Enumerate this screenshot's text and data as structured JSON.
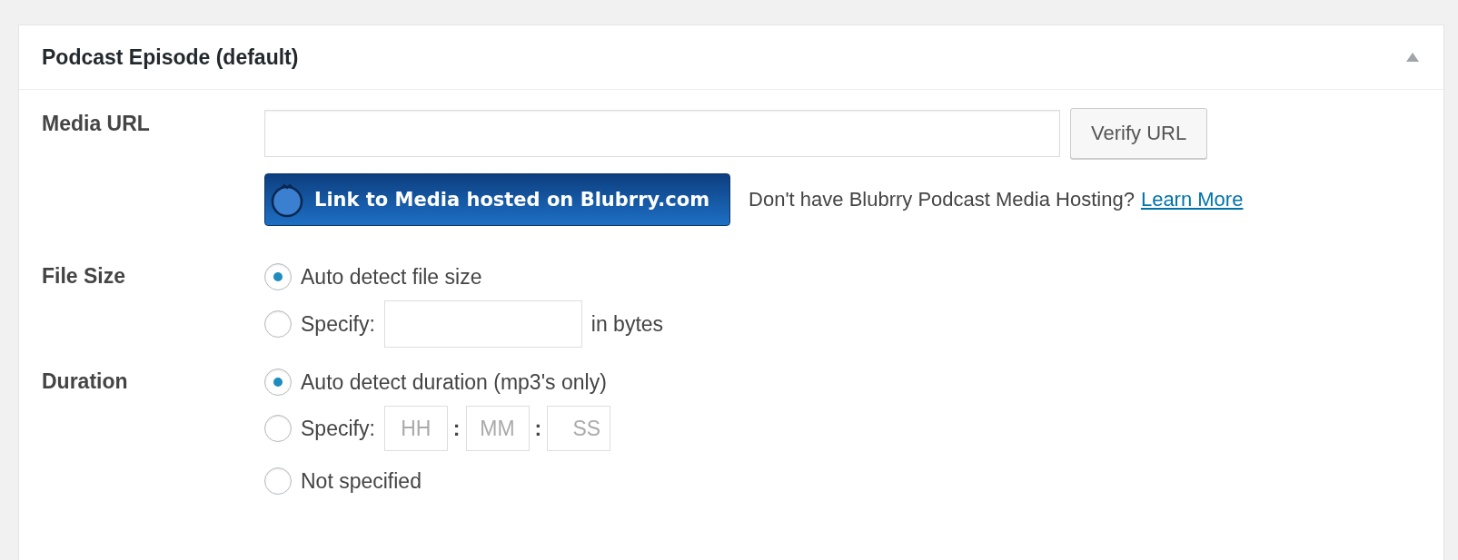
{
  "panel": {
    "title": "Podcast Episode (default)",
    "expanded": true
  },
  "media_url": {
    "label": "Media URL",
    "button": "Verify URL",
    "hosted_button": "Link to Media hosted on Blubrry.com",
    "hosting_note": "Don't have Blubrry Podcast Media Hosting?",
    "learn_more": "Learn More"
  },
  "file_size": {
    "label": "File Size",
    "options": [
      {
        "kind": "plain",
        "label": "Auto detect file size",
        "selected": true
      },
      {
        "kind": "size",
        "label": "Specify:",
        "suffix": "in bytes",
        "selected": false
      }
    ]
  },
  "duration": {
    "label": "Duration",
    "options": [
      {
        "kind": "plain",
        "label": "Auto detect duration (mp3's only)",
        "selected": true
      },
      {
        "kind": "time",
        "label": "Specify:",
        "placeholders": [
          "HH",
          "MM",
          "SS"
        ],
        "separators": [
          ":",
          ":"
        ],
        "selected": false
      },
      {
        "kind": "plain",
        "label": "Not specified",
        "selected": false
      }
    ]
  }
}
